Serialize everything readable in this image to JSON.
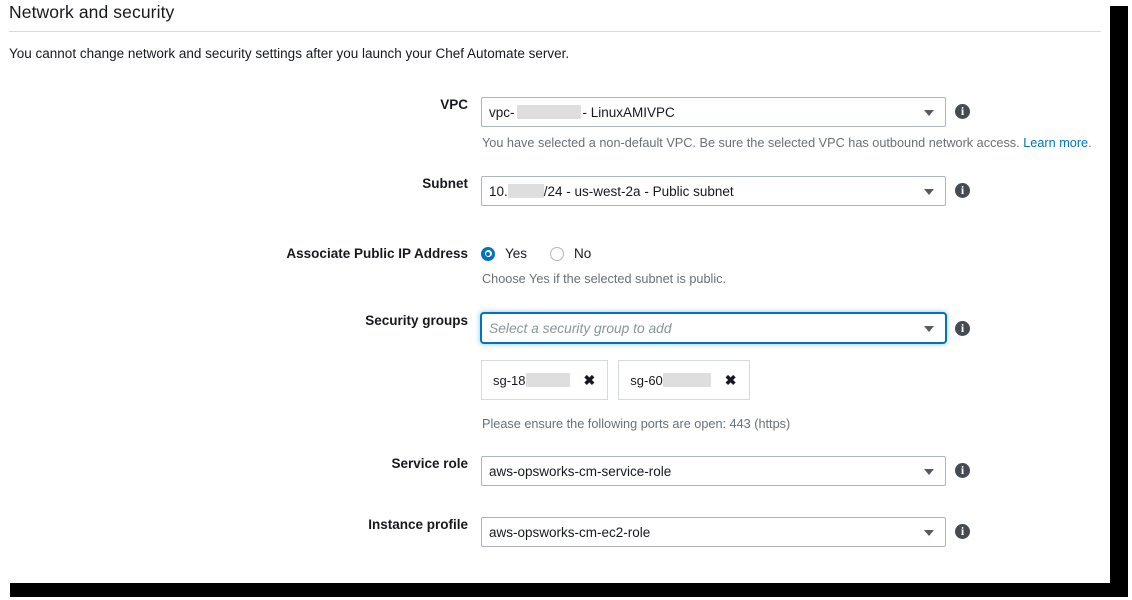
{
  "panel": {
    "title": "Network and security",
    "description": "You cannot change network and security settings after you launch your Chef Automate server."
  },
  "fields": {
    "vpc": {
      "label": "VPC",
      "value_prefix": "vpc-",
      "value_suffix": " - LinuxAMIVPC",
      "redacted": true,
      "helper": "You have selected a non-default VPC. Be sure the selected VPC has outbound network access.",
      "helper_link": "Learn more",
      "helper_link_suffix": ".",
      "info_icon": "info-icon",
      "caret_icon": "chevron-down-icon"
    },
    "subnet": {
      "label": "Subnet",
      "value_prefix": "10.",
      "value_suffix": "/24 - us-west-2a - Public subnet",
      "redacted": true,
      "info_icon": "info-icon",
      "caret_icon": "chevron-down-icon"
    },
    "public_ip": {
      "label": "Associate Public IP Address",
      "options": [
        {
          "label": "Yes",
          "selected": true
        },
        {
          "label": "No",
          "selected": false
        }
      ],
      "helper": "Choose Yes if the selected subnet is public."
    },
    "security_groups": {
      "label": "Security groups",
      "placeholder": "Select a security group to add",
      "value": "",
      "focused": true,
      "info_icon": "info-icon",
      "caret_icon": "chevron-down-icon",
      "chips": [
        {
          "label": "sg-18",
          "redacted": true,
          "remove_icon": "close-icon"
        },
        {
          "label": "sg-60",
          "redacted": true,
          "remove_icon": "close-icon"
        }
      ],
      "helper": "Please ensure the following ports are open: 443 (https)"
    },
    "service_role": {
      "label": "Service role",
      "value": "aws-opsworks-cm-service-role",
      "info_icon": "info-icon",
      "caret_icon": "chevron-down-icon"
    },
    "instance_profile": {
      "label": "Instance profile",
      "value": "aws-opsworks-cm-ec2-role",
      "info_icon": "info-icon",
      "caret_icon": "chevron-down-icon"
    }
  },
  "icons": {
    "info_glyph": "i"
  },
  "colors": {
    "accent_blue": "#0073bb",
    "text_primary": "#16191f",
    "text_muted": "#687078",
    "border": "#aab7b8",
    "redaction": "#dedede",
    "frame": "#000000"
  }
}
